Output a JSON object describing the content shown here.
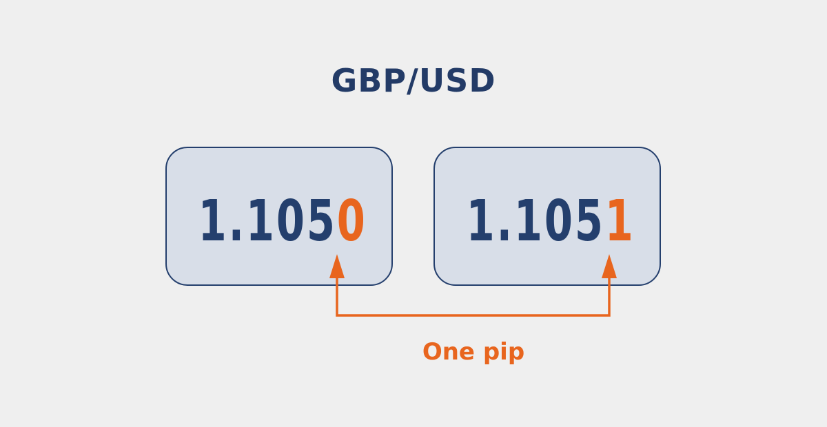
{
  "title": "GBP/USD",
  "quotes": [
    {
      "prefix": "1.105",
      "highlight": "0"
    },
    {
      "prefix": "1.105",
      "highlight": "1"
    }
  ],
  "caption": "One pip",
  "colors": {
    "background": "#efefef",
    "primary": "#243f6d",
    "accent": "#e8651e",
    "box_fill": "#d8dee8"
  }
}
